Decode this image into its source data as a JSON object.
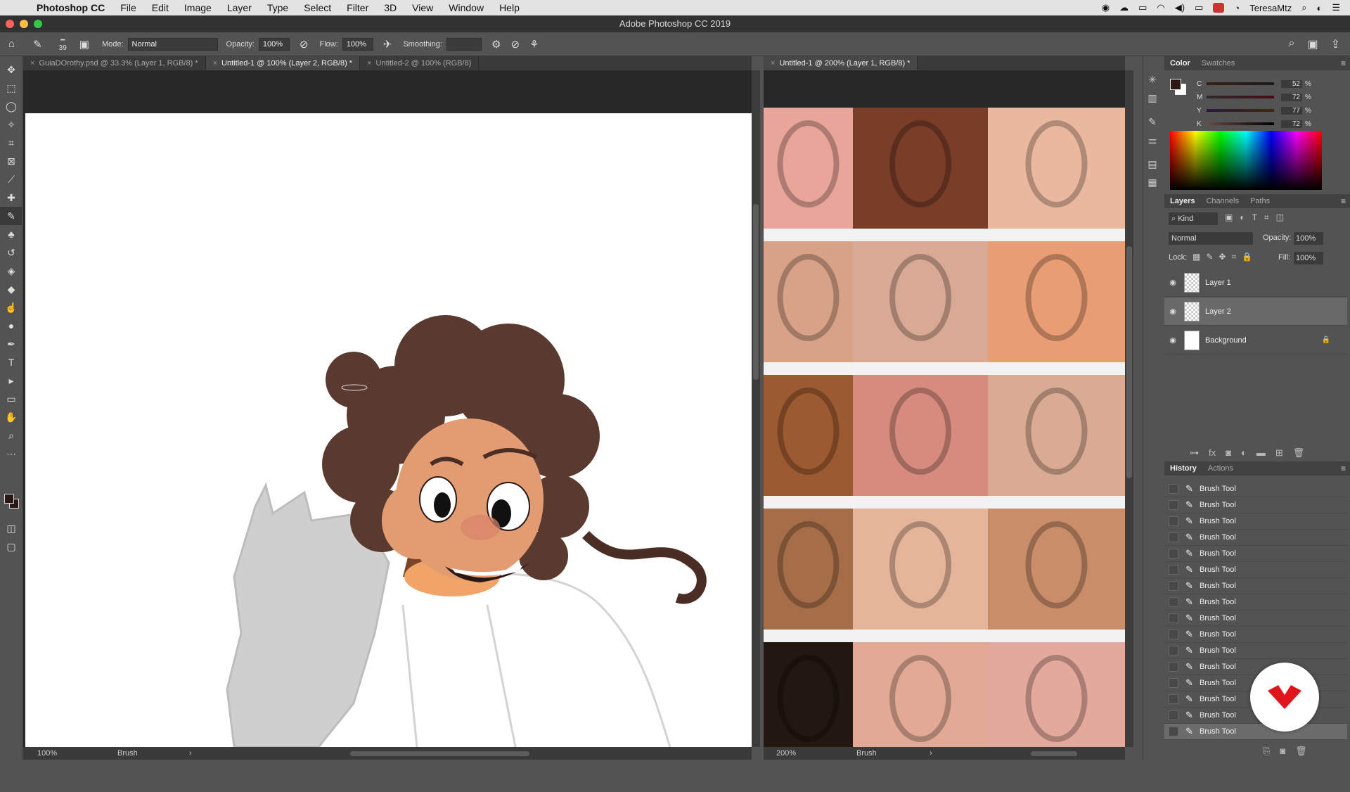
{
  "menubar": {
    "app": "Photoshop CC",
    "items": [
      "File",
      "Edit",
      "Image",
      "Layer",
      "Type",
      "Select",
      "Filter",
      "3D",
      "View",
      "Window",
      "Help"
    ],
    "user": "TeresaMtz"
  },
  "window": {
    "title": "Adobe Photoshop CC 2019"
  },
  "options": {
    "brush_size": "39",
    "mode_label": "Mode:",
    "mode_value": "Normal",
    "opacity_label": "Opacity:",
    "opacity_value": "100%",
    "flow_label": "Flow:",
    "flow_value": "100%",
    "smoothing_label": "Smoothing:"
  },
  "left_doc": {
    "tabs": [
      "GuiaDOrothy.psd @ 33.3% (Layer 1, RGB/8) *",
      "Untitled-1 @ 100% (Layer 2, RGB/8) *",
      "Untitled-2 @ 100% (RGB/8)"
    ],
    "zoom": "100%",
    "status": "Brush"
  },
  "right_doc": {
    "tab": "Untitled-1 @ 200% (Layer 1, RGB/8) *",
    "zoom": "200%",
    "status": "Brush",
    "skin_tones": [
      "#e8a599",
      "#7a3d28",
      "#e9b89f",
      "#d7a287",
      "#d8a995",
      "#e89d74",
      "#9c5a30",
      "#d78b7e",
      "#d9ab92",
      "#a66e48",
      "#e5b59a",
      "#c98d6a",
      "#231711",
      "#e2aa95",
      "#e3a99c"
    ]
  },
  "color_panel": {
    "tabs": [
      "Color",
      "Swatches"
    ],
    "channels": [
      {
        "label": "C",
        "value": "52"
      },
      {
        "label": "M",
        "value": "72"
      },
      {
        "label": "Y",
        "value": "77"
      },
      {
        "label": "K",
        "value": "72"
      }
    ],
    "unit": "%",
    "fg_color": "#2a1814"
  },
  "layers_panel": {
    "tabs": [
      "Layers",
      "Channels",
      "Paths"
    ],
    "filter_kind": "Kind",
    "blend_mode": "Normal",
    "opacity_label": "Opacity:",
    "opacity_value": "100%",
    "lock_label": "Lock:",
    "fill_label": "Fill:",
    "fill_value": "100%",
    "layers": [
      "Layer 1",
      "Layer 2",
      "Background"
    ]
  },
  "history_panel": {
    "tabs": [
      "History",
      "Actions"
    ],
    "items": [
      "Brush Tool",
      "Brush Tool",
      "Brush Tool",
      "Brush Tool",
      "Brush Tool",
      "Brush Tool",
      "Brush Tool",
      "Brush Tool",
      "Brush Tool",
      "Brush Tool",
      "Brush Tool",
      "Brush Tool",
      "Brush Tool",
      "Brush Tool",
      "Brush Tool",
      "Brush Tool"
    ]
  }
}
